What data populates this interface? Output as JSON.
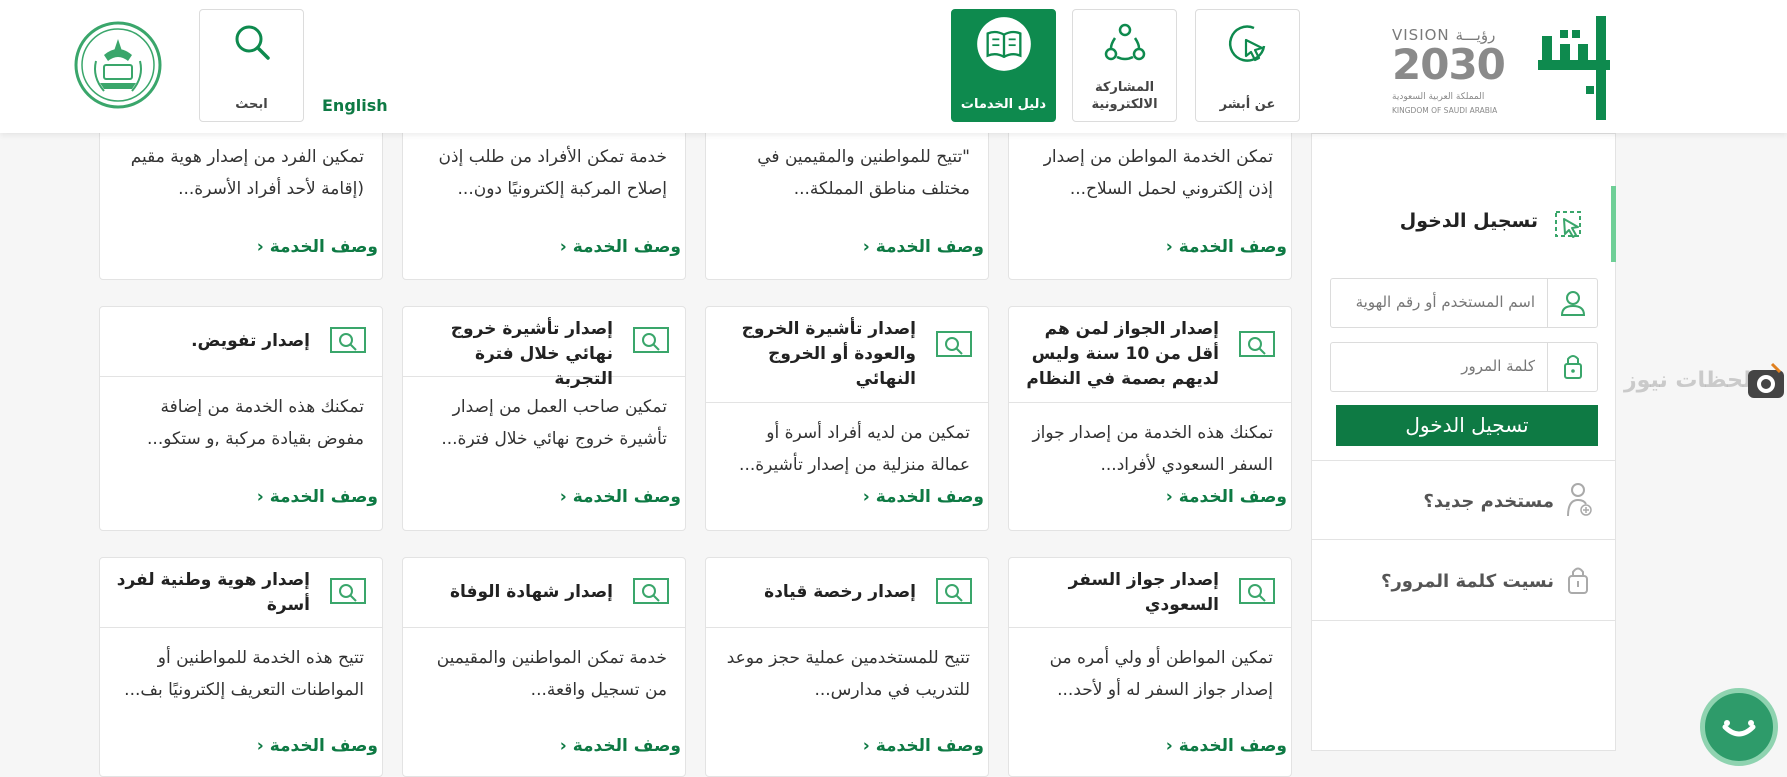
{
  "header": {
    "vision_title": "VISION رؤيـــة",
    "vision_year": "2030",
    "vision_sub_ar": "المملكة العربية السعودية",
    "vision_sub_en": "KINGDOM OF SAUDI ARABIA",
    "brand_logo_text": "أبشر",
    "nav": {
      "about": "عن أبشر",
      "participation_line1": "المشاركة",
      "participation_line2": "الالكترونية",
      "services_guide": "دليل الخدمات",
      "search": "ابحث"
    },
    "language_link": "English",
    "accent_color": "#0e8a4e"
  },
  "cards_row1": [
    {
      "desc": "تمكن الخدمة المواطن من إصدار إذن إلكتروني لحمل السلاح...",
      "more": "وصف الخدمة ‹"
    },
    {
      "desc": "\"تتيح للمواطنين والمقيمين في مختلف مناطق المملكة...",
      "more": "وصف الخدمة ‹"
    },
    {
      "desc": "خدمة تمكن الأفراد من طلب إذن إصلاح المركبة إلكترونيًا دون...",
      "more": "وصف الخدمة ‹"
    },
    {
      "desc": "تمكين الفرد من إصدار هوية مقيم (إقامة لأحد أفراد الأسرة...",
      "more": "وصف الخدمة ‹"
    }
  ],
  "cards_row2": [
    {
      "title": "إصدار الجواز لمن هم أقل من 10 سنة وليس لديهم بصمة في النظام",
      "desc": "تمكنك هذه الخدمة من إصدار جواز السفر السعودي لأفراد...",
      "more": "وصف الخدمة ‹"
    },
    {
      "title": "إصدار تأشيرة الخروج والعودة أو الخروج النهائي",
      "desc": "تمكين من لديه أفراد أسرة أو عمالة منزلية من إصدار تأشيرة...",
      "more": "وصف الخدمة ‹"
    },
    {
      "title": "إصدار تأشيرة خروج نهائي خلال فترة التجربة",
      "desc": "تمكين صاحب العمل من إصدار تأشيرة خروج نهائي خلال فترة...",
      "more": "وصف الخدمة ‹"
    },
    {
      "title": "إصدار تفويض.",
      "desc": "تمكنك هذه الخدمة من إضافة مفوض بقيادة مركبة ,و ستكو...",
      "more": "وصف الخدمة ‹"
    }
  ],
  "cards_row3": [
    {
      "title": "إصدار جواز السفر السعودي",
      "desc": "تمكين المواطن أو ولي أمره من إصدار جواز السفر له أو لأحد...",
      "more": "وصف الخدمة ‹"
    },
    {
      "title": "إصدار رخصة قيادة",
      "desc": "تتيح للمستخدمين عملية حجز موعد للتدريب في مدارس...",
      "more": "وصف الخدمة ‹"
    },
    {
      "title": "إصدار شهادة الوفاة",
      "desc": "خدمة تمكن المواطنين والمقيمين من تسجيل واقعة...",
      "more": "وصف الخدمة ‹"
    },
    {
      "title": "إصدار هوية وطنية لفرد أسرة",
      "desc": "تتيح هذه الخدمة للمواطنين أو المواطنات التعريف إلكترونيًا بف...",
      "more": "وصف الخدمة ‹"
    }
  ],
  "login": {
    "title": "تسجيل الدخول",
    "username_placeholder": "اسم المستخدم أو رقم الهوية",
    "password_placeholder": "كلمة المرور",
    "submit": "تسجيل الدخول",
    "new_user": "مستخدم جديد؟",
    "forgot_password": "نسيت كلمة المرور؟"
  },
  "watermark": "لحظات نيوز"
}
